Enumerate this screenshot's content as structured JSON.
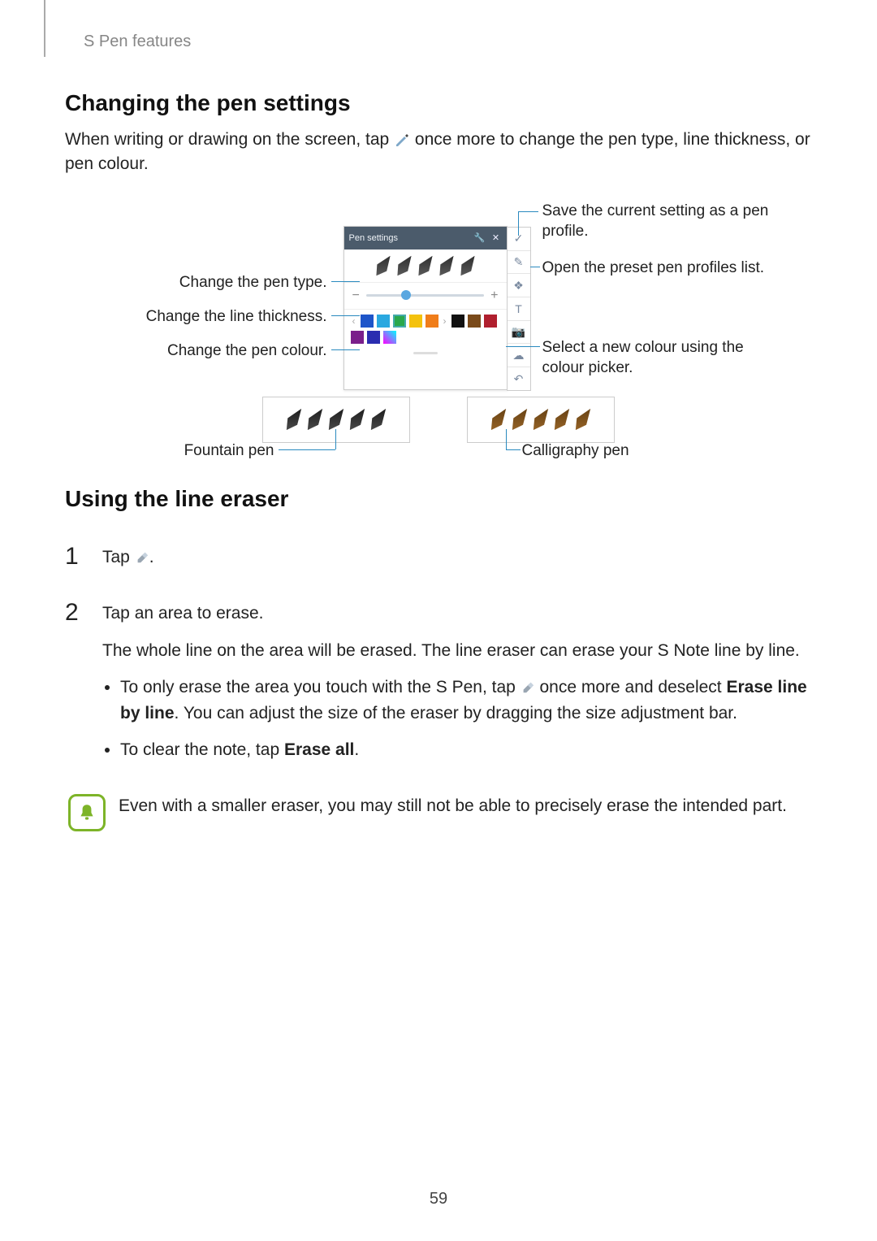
{
  "breadcrumb": "S Pen features",
  "section1": {
    "title": "Changing the pen settings",
    "intro_before": "When writing or drawing on the screen, tap ",
    "intro_after": " once more to change the pen type, line thickness, or pen colour."
  },
  "diagram": {
    "panel_title": "Pen settings",
    "left": {
      "type": "Change the pen type.",
      "thickness": "Change the line thickness.",
      "colour": "Change the pen colour."
    },
    "right": {
      "save": "Save the current setting as a pen profile.",
      "preset": "Open the preset pen profiles list.",
      "picker": "Select a new colour using the colour picker."
    },
    "fountain": "Fountain pen",
    "calligraphy": "Calligraphy pen",
    "swatches_top": [
      "#1e55c9",
      "#2aa8e0",
      "#2aa84c",
      "#f4c20d",
      "#f07d1a",
      "#dcdcdc"
    ],
    "swatches_bot": [
      "#111111",
      "#7a4a1a",
      "#b01f2e",
      "#7a1f8b",
      "#2a2db0",
      "#dcdcdc"
    ]
  },
  "section2": {
    "title": "Using the line eraser",
    "step1_before": "Tap ",
    "step1_after": ".",
    "step2_line1": "Tap an area to erase.",
    "step2_line2": "The whole line on the area will be erased. The line eraser can erase your S Note line by line.",
    "bul1_before": "To only erase the area you touch with the S Pen, tap ",
    "bul1_mid": " once more and deselect ",
    "bul1_bold": "Erase line by line",
    "bul1_after": ". You can adjust the size of the eraser by dragging the size adjustment bar.",
    "bul2_before": "To clear the note, tap ",
    "bul2_bold": "Erase all",
    "bul2_after": "."
  },
  "note": "Even with a smaller eraser, you may still not be able to precisely erase the intended part.",
  "page_number": "59"
}
